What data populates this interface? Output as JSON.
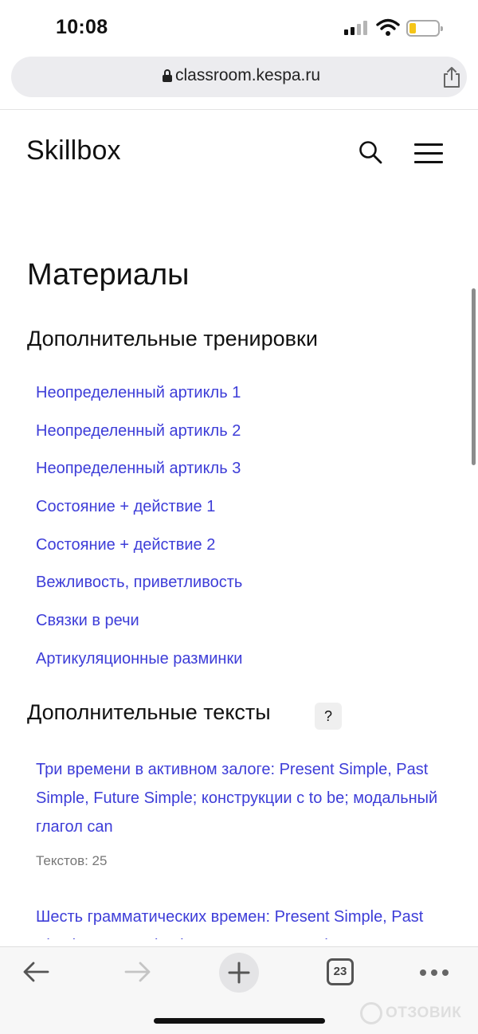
{
  "status_bar": {
    "time": "10:08"
  },
  "browser": {
    "url": "classroom.kespa.ru",
    "open_tabs_count": "23"
  },
  "site": {
    "logo": "Skillbox"
  },
  "page": {
    "title": "Материалы",
    "trainings": {
      "heading": "Дополнительные тренировки",
      "items": [
        "Неопределенный артикль 1",
        "Неопределенный артикль 2",
        "Неопределенный артикль 3",
        "Состояние + действие 1",
        "Состояние + действие 2",
        "Вежливость, приветливость",
        "Связки в речи",
        "Артикуляционные разминки"
      ]
    },
    "texts": {
      "heading": "Дополнительные тексты",
      "help": "?",
      "items": [
        {
          "title": "Три времени в активном залоге: Present Simple, Past Simple, Future Simple; конструкции с to be; модальный глагол can",
          "count_label": "Текстов: 25"
        },
        {
          "title": "Шесть грамматических времен: Present Simple, Past Simple, Future Simple, Present Progressive, Past"
        }
      ]
    }
  },
  "watermark": {
    "text": "ОТЗОВИК"
  },
  "colors": {
    "link": "#3d3dd8",
    "battery": "#f5c518"
  }
}
